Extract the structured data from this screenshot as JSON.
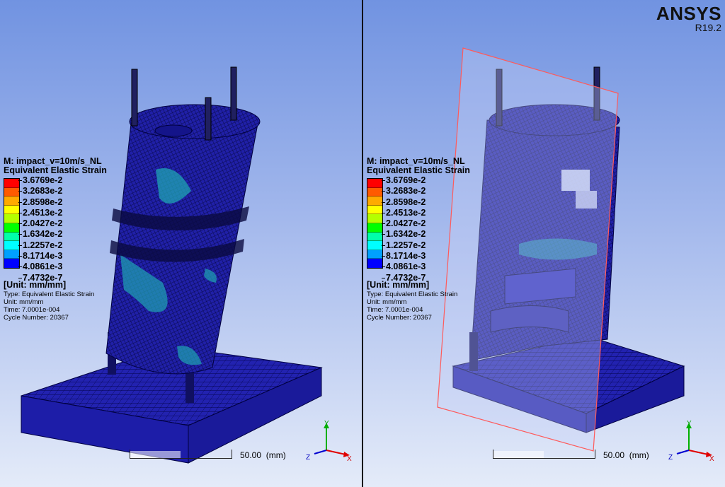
{
  "app": {
    "brand": "ANSYS",
    "version": "R19.2"
  },
  "result": {
    "model": "M: impact_v=10m/s_NL",
    "quantity": "Equivalent Elastic Strain",
    "unit_label": "[Unit: mm/mm]",
    "type_line": "Type: Equivalent Elastic Strain",
    "unit_line": "Unit: mm/mm",
    "time_line": "Time: 7.0001e-004",
    "cycle_line": "Cycle Number: 20367",
    "legend_values": [
      "3.6769e-2",
      "3.2683e-2",
      "2.8598e-2",
      "2.4513e-2",
      "2.0427e-2",
      "1.6342e-2",
      "1.2257e-2",
      "8.1714e-3",
      "4.0861e-3",
      "7.4732e-7"
    ],
    "legend_colors": [
      "#ff0000",
      "#ff5a00",
      "#ffaa00",
      "#ffff00",
      "#b4ff00",
      "#00ff00",
      "#00ffaa",
      "#00ffff",
      "#00a0ff",
      "#0000ff"
    ]
  },
  "scale": {
    "value": "50.00",
    "unit": "(mm)"
  },
  "axes": {
    "x": "X",
    "y": "Y",
    "z": "Z"
  },
  "colors": {
    "mesh": "#2a2ab8",
    "strain_low": "#1a1aa0",
    "strain_mid": "#20b0b0",
    "section_plane": "#ff5a5a"
  }
}
